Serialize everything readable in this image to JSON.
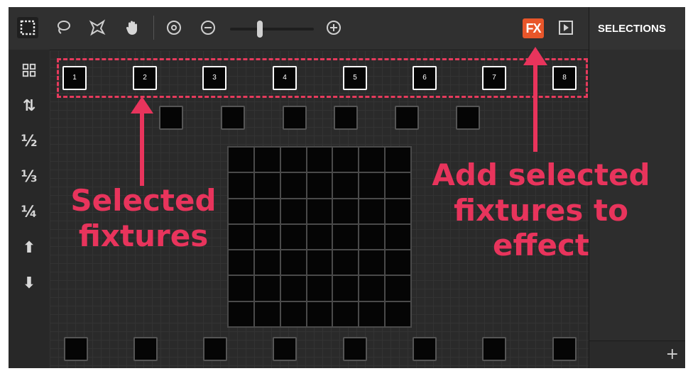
{
  "toolbar": {
    "tools": [
      {
        "icon": "rect-select-icon",
        "active": true
      },
      {
        "icon": "lasso-icon"
      },
      {
        "icon": "magic-select-icon"
      },
      {
        "icon": "hand-icon"
      },
      {
        "icon": "zoom-fit-icon"
      },
      {
        "icon": "zoom-out-icon"
      },
      {
        "icon": "zoom-in-icon"
      }
    ],
    "zoom_level": 0.35,
    "fx_label": "FX",
    "fx_color": "#e8562a"
  },
  "panel": {
    "title": "SELECTIONS",
    "add_label": "+"
  },
  "left_tools": [
    {
      "icon": "grid-icon",
      "label": ""
    },
    {
      "icon": "swap-order-icon",
      "label": "⇅"
    },
    {
      "icon": "half-icon",
      "label": "½"
    },
    {
      "icon": "third-icon",
      "label": "⅓"
    },
    {
      "icon": "quarter-icon",
      "label": "¼"
    },
    {
      "icon": "arrow-up-icon",
      "label": "⬆"
    },
    {
      "icon": "arrow-down-icon",
      "label": "⬇"
    }
  ],
  "fixtures": {
    "selected_row": [
      "1",
      "2",
      "3",
      "4",
      "5",
      "6",
      "7",
      "8"
    ]
  },
  "annotations": {
    "selected_label": "Selected fixtures",
    "fx_label": "Add selected fixtures to effect",
    "color": "#e8345c"
  }
}
